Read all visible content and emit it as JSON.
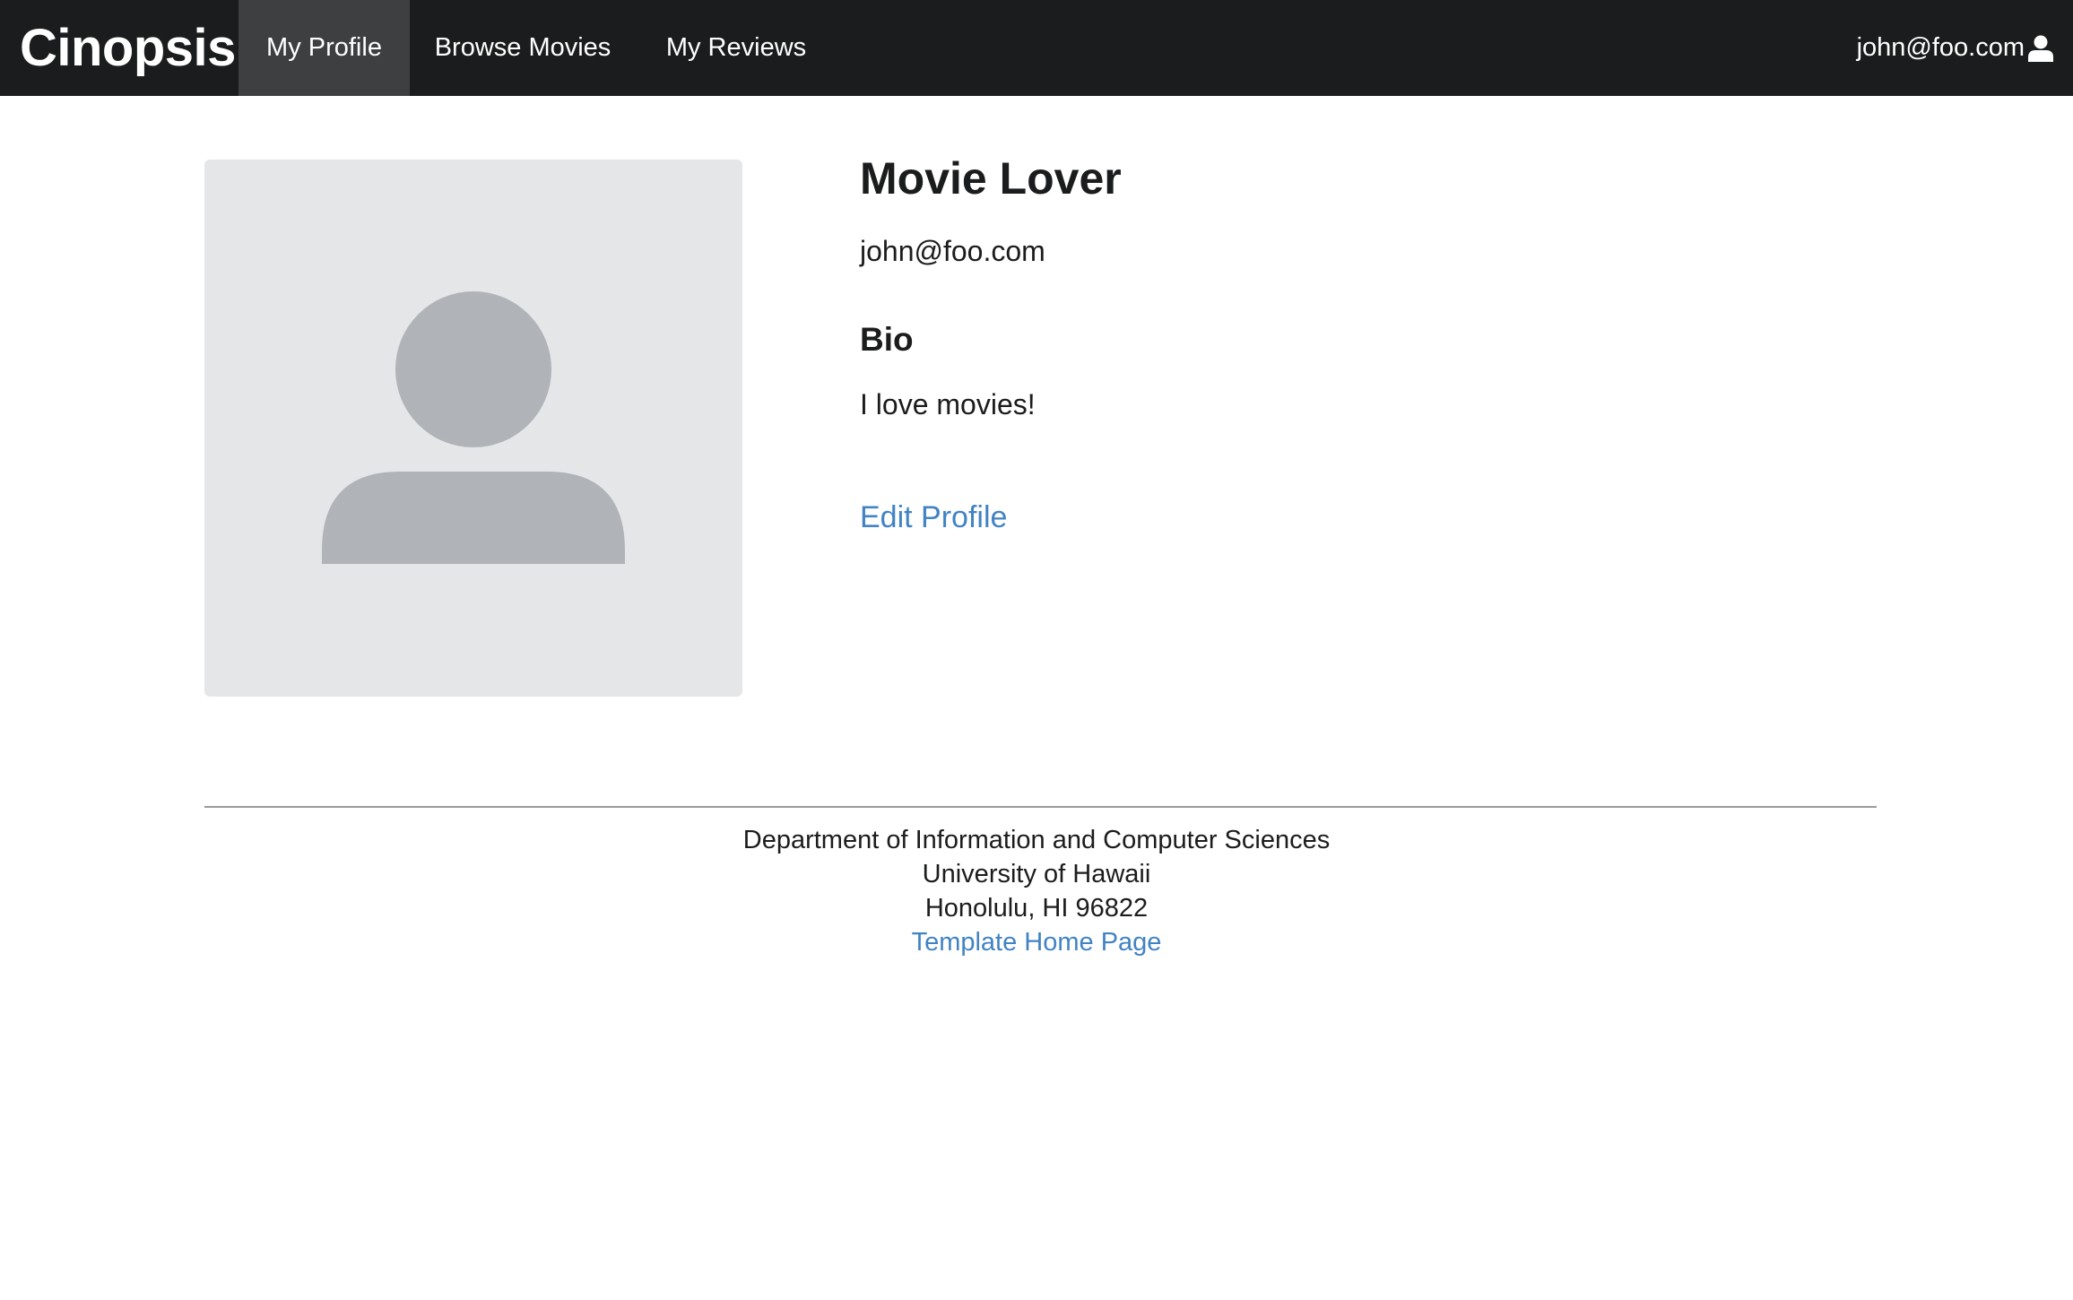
{
  "navbar": {
    "brand": "Cinopsis",
    "items": [
      {
        "label": "My Profile",
        "active": true
      },
      {
        "label": "Browse Movies",
        "active": false
      },
      {
        "label": "My Reviews",
        "active": false
      }
    ],
    "user": {
      "email": "john@foo.com",
      "icon": "user-icon"
    }
  },
  "profile": {
    "avatar_icon": "avatar-placeholder-icon",
    "name": "Movie Lover",
    "email": "john@foo.com",
    "bio_heading": "Bio",
    "bio_text": "I love movies!",
    "edit_link": "Edit Profile"
  },
  "footer": {
    "line1": "Department of Information and Computer Sciences",
    "line2": "University of Hawaii",
    "line3": "Honolulu, HI 96822",
    "link": "Template Home Page"
  },
  "colors": {
    "navbar_bg": "#1b1c1d",
    "active_nav_bg": "#3e3f41",
    "link": "#4183c4",
    "avatar_bg": "#e5e6e8",
    "avatar_shape": "#b0b3b7"
  }
}
